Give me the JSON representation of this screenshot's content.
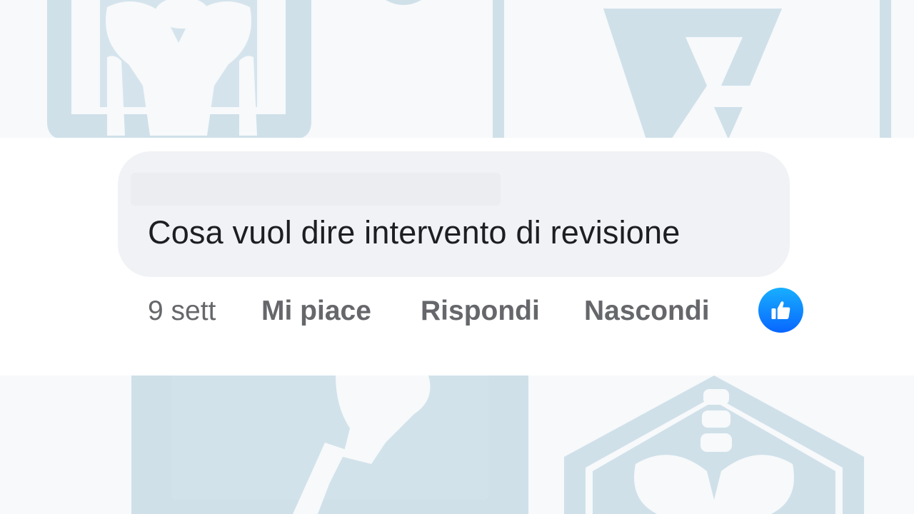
{
  "comment": {
    "text": "Cosa vuol dire intervento di revisione"
  },
  "actions": {
    "timestamp": "9 sett",
    "like_label": "Mi piace",
    "reply_label": "Rispondi",
    "hide_label": "Nascondi"
  },
  "reaction": {
    "icon": "thumbs-up-icon",
    "color": "#0866ff"
  },
  "background": {
    "color": "#f7f9fa",
    "art_color": "#cfe0e9",
    "icons": [
      "pelvis-icon",
      "knee-joint-icon",
      "spine-pelvis-icon",
      "logo-letter-icon"
    ]
  }
}
